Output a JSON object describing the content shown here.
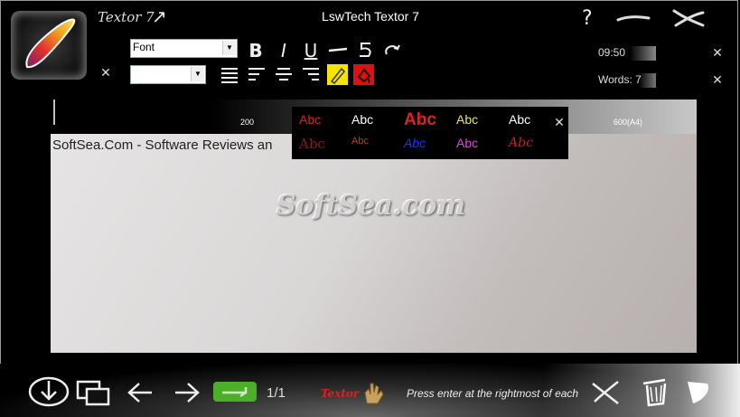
{
  "window": {
    "title": "LswTech Textor 7",
    "logo_word": "Textor 7"
  },
  "toolbar": {
    "font_combo": {
      "value": "Font"
    },
    "size_combo": {
      "value": ""
    },
    "bold": "B",
    "italic": "I",
    "underline": "U",
    "highlight_color": "#f5e400",
    "text_color_btn": "#e01010"
  },
  "status": {
    "clock": "09:50",
    "words": "Words: 7"
  },
  "ruler": {
    "labels": [
      "200",
      "600(A4)"
    ]
  },
  "palette": {
    "swatches": [
      {
        "text": "Abc",
        "color": "#e02020",
        "style": "normal"
      },
      {
        "text": "Abc",
        "color": "#ffffff",
        "style": "normal"
      },
      {
        "text": "Abc",
        "color": "#d8232a",
        "style": "bold-large"
      },
      {
        "text": "Abc",
        "color": "#e8e46a",
        "style": "normal"
      },
      {
        "text": "Abc",
        "color": "#ffffff",
        "style": "normal"
      },
      {
        "text": "Abc",
        "color": "#8a1a1a",
        "style": "serif"
      },
      {
        "text": "Abc",
        "color": "#c0392b",
        "style": "small"
      },
      {
        "text": "Abc",
        "color": "#2233ff",
        "style": "italic"
      },
      {
        "text": "Abc",
        "color": "#e040e0",
        "style": "normal"
      },
      {
        "text": "Abc",
        "color": "#d02020",
        "style": "script"
      }
    ]
  },
  "document": {
    "text": "SoftSea.Com - Software Reviews an",
    "watermark": "SoftSea.com"
  },
  "bottom": {
    "page_indicator": "1/1",
    "brand": "Textor",
    "hint": "Press enter at the rightmost of each",
    "accent_green": "#4caf2a"
  }
}
